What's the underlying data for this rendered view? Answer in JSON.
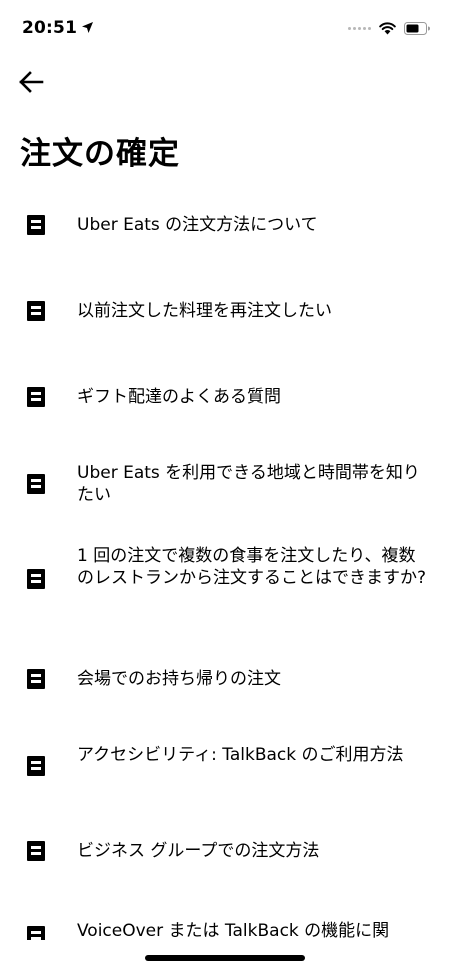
{
  "status_bar": {
    "time": "20:51"
  },
  "page": {
    "title": "注文の確定"
  },
  "articles": [
    {
      "label": "Uber Eats の注文方法について"
    },
    {
      "label": "以前注文した料理を再注文したい"
    },
    {
      "label": "ギフト配達のよくある質問"
    },
    {
      "label": "Uber Eats を利用できる地域と時間帯を知りたい"
    },
    {
      "label": "1 回の注文で複数の食事を注文したり、複数のレストランから注文することはできますか?"
    },
    {
      "label": "会場でのお持ち帰りの注文"
    },
    {
      "label": "アクセシビリティ: TalkBack のご利用方法"
    },
    {
      "label": "ビジネス グループでの注文方法"
    },
    {
      "label": "VoiceOver または TalkBack の機能に関"
    }
  ],
  "icons": {
    "back": "arrow-left-icon",
    "article": "document-icon",
    "location": "location-arrow-icon",
    "wifi": "wifi-icon",
    "battery": "battery-icon"
  }
}
